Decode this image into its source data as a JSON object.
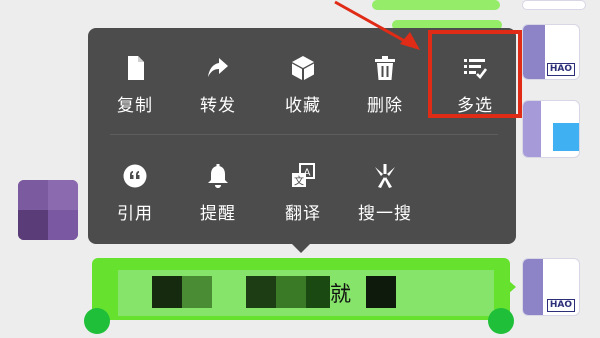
{
  "menu": {
    "row1": [
      {
        "icon": "file-icon",
        "label": "复制"
      },
      {
        "icon": "share-arrow-icon",
        "label": "转发"
      },
      {
        "icon": "cube-icon",
        "label": "收藏"
      },
      {
        "icon": "trash-icon",
        "label": "删除"
      },
      {
        "icon": "multiselect-list-icon",
        "label": "多选"
      }
    ],
    "row2": [
      {
        "icon": "quote-icon",
        "label": "引用"
      },
      {
        "icon": "bell-icon",
        "label": "提醒"
      },
      {
        "icon": "translate-icon",
        "label": "翻译"
      },
      {
        "icon": "search-spark-icon",
        "label": "搜一搜"
      }
    ]
  },
  "avatar_badge": "HAO",
  "message": {
    "visible_text": "就"
  },
  "colors": {
    "menu_bg": "#4c4c4c",
    "highlight": "#e02b17",
    "bubble_green": "#95ec69",
    "selected_green": "#66e22e",
    "handle_green": "#1fbf3a"
  },
  "icon_glyphs": {
    "translate_left": "文",
    "translate_right": "A"
  }
}
